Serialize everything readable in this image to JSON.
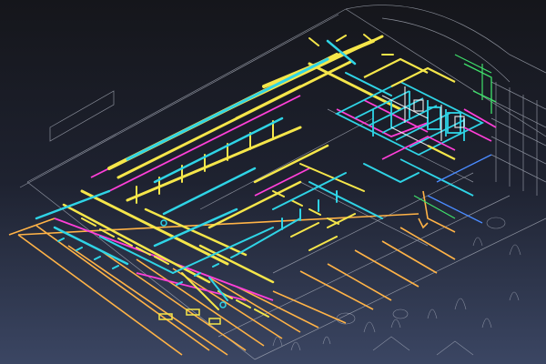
{
  "scene": {
    "background_top": "#17181d",
    "background_bottom": "#3a4461",
    "colors": {
      "architecture": "#c8ccd6",
      "supply_duct": "#f5e64a",
      "return_duct": "#2fd4e6",
      "exhaust_duct": "#ff3fd8",
      "hydronic_pipe": "#ffb347",
      "sprinkler_pipe": "#3fe06a",
      "plumbing_pipe": "#4a8bff"
    }
  }
}
